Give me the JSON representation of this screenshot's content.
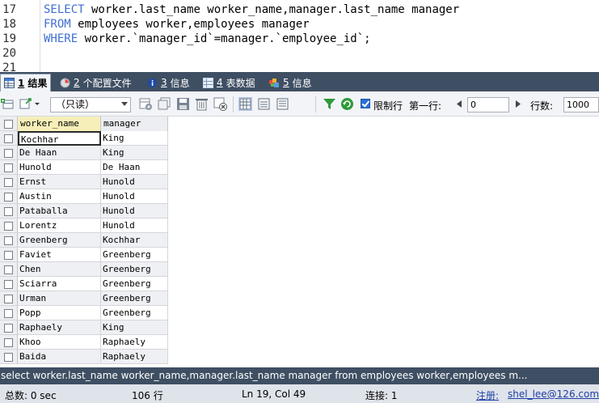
{
  "editor": {
    "lines": [
      {
        "num": "17",
        "keyword": "SELECT",
        "rest": " worker.last_name worker_name,manager.last_name manager"
      },
      {
        "num": "18",
        "keyword": "FROM",
        "rest": " employees worker,employees manager"
      },
      {
        "num": "19",
        "keyword": "WHERE",
        "rest": " worker.`manager_id`=manager.`employee_id`;"
      },
      {
        "num": "20",
        "keyword": "",
        "rest": ""
      },
      {
        "num": "21",
        "keyword": "",
        "rest": ""
      }
    ]
  },
  "tabs": [
    {
      "num": "1",
      "label": "结果",
      "icon": "result-grid-icon",
      "active": true
    },
    {
      "num": "2",
      "label": "个配置文件",
      "icon": "profile-icon",
      "active": false
    },
    {
      "num": "3",
      "label": "信息",
      "icon": "info-icon",
      "active": false
    },
    {
      "num": "4",
      "label": "表数据",
      "icon": "table-data-icon",
      "active": false
    },
    {
      "num": "5",
      "label": "信息",
      "icon": "info-colored-icon",
      "active": false
    }
  ],
  "toolbar": {
    "mode_select": "（只读）",
    "limit_rows_label": "限制行",
    "limit_rows_checked": true,
    "first_row_label": "第一行:",
    "first_row_value": "0",
    "rows_label": "行数:",
    "rows_value": "1000"
  },
  "grid": {
    "columns": [
      "worker_name",
      "manager"
    ],
    "rows": [
      [
        "Kochhar",
        "King"
      ],
      [
        "De Haan",
        "King"
      ],
      [
        "Hunold",
        "De Haan"
      ],
      [
        "Ernst",
        "Hunold"
      ],
      [
        "Austin",
        "Hunold"
      ],
      [
        "Pataballa",
        "Hunold"
      ],
      [
        "Lorentz",
        "Hunold"
      ],
      [
        "Greenberg",
        "Kochhar"
      ],
      [
        "Faviet",
        "Greenberg"
      ],
      [
        "Chen",
        "Greenberg"
      ],
      [
        "Sciarra",
        "Greenberg"
      ],
      [
        "Urman",
        "Greenberg"
      ],
      [
        "Popp",
        "Greenberg"
      ],
      [
        "Raphaely",
        "King"
      ],
      [
        "Khoo",
        "Raphaely"
      ],
      [
        "Baida",
        "Raphaely"
      ]
    ]
  },
  "sql_bar": "select worker.last_name worker_name,manager.last_name manager from employees worker,employees m...",
  "status": {
    "total": "总数: 0 sec",
    "rows": "106 行",
    "position": "Ln 19, Col 49",
    "connections": "连接: 1",
    "register_label": "注册:",
    "register_user": "shel_lee@126.com"
  },
  "colors": {
    "keyword": "#3f6fd2",
    "tabbar_bg": "#3f4f63",
    "header_highlight": "#f6efb9"
  }
}
